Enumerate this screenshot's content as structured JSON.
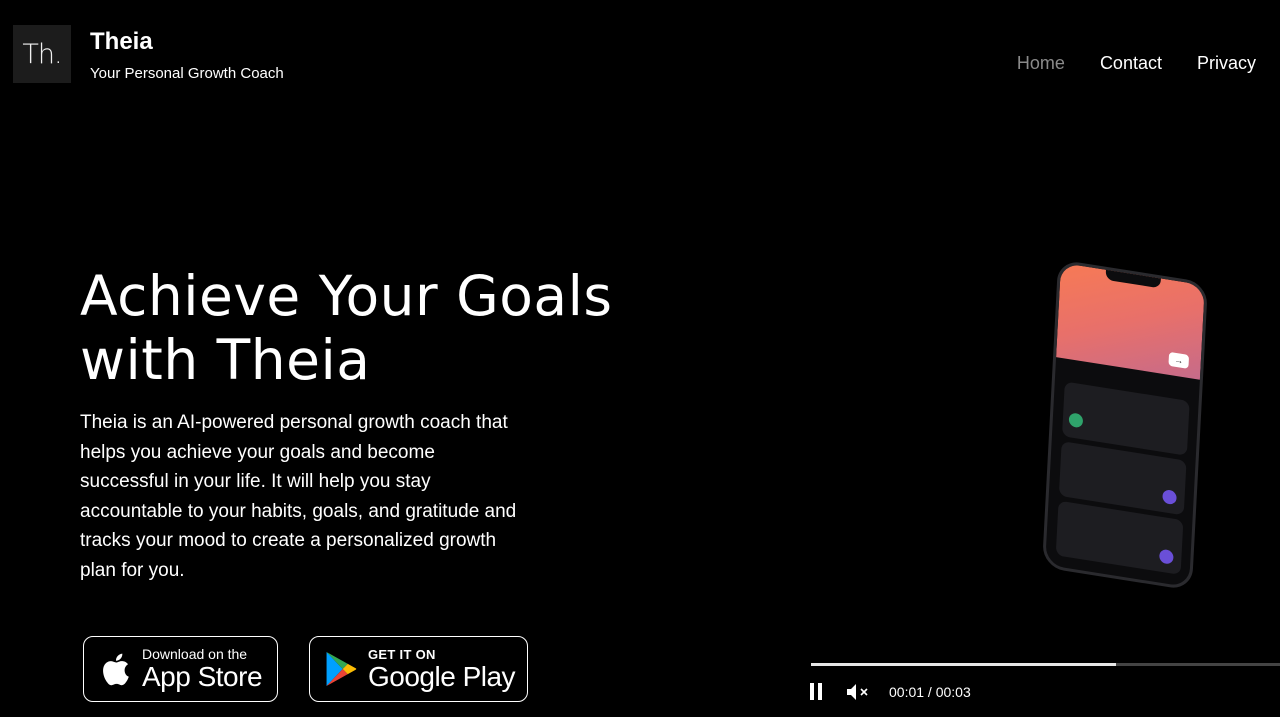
{
  "header": {
    "logo_text": "Th.",
    "brand_name": "Theia",
    "tagline": "Your Personal Growth Coach",
    "nav": [
      {
        "label": "Home",
        "active": true
      },
      {
        "label": "Contact",
        "active": false
      },
      {
        "label": "Privacy",
        "active": false
      }
    ]
  },
  "hero": {
    "title": "Achieve Your Goals with Theia",
    "description": "Theia is an AI-powered personal growth coach that helps you achieve your goals and become successful in your life. It will help you stay accountable to your habits, goals, and gratitude and tracks your mood to create a personalized growth plan for you."
  },
  "store_buttons": {
    "apple": {
      "small": "Download on the",
      "big": "App Store",
      "icon": "apple-icon"
    },
    "google": {
      "small": "GET IT ON",
      "big": "Google Play",
      "icon": "google-play-icon"
    }
  },
  "video": {
    "time_display": "00:01 / 00:03",
    "progress": 0.65,
    "muted": true,
    "playing": true,
    "icons": [
      "pause-icon",
      "muted-speaker-icon"
    ]
  },
  "colors": {
    "background": "#000000",
    "nav_active": "#8a8a8a",
    "phone_gradient_start": "#f77a55",
    "phone_gradient_end": "#c66b8a",
    "play_green": "#2fa36b",
    "play_purple": "#6a4fd8"
  }
}
